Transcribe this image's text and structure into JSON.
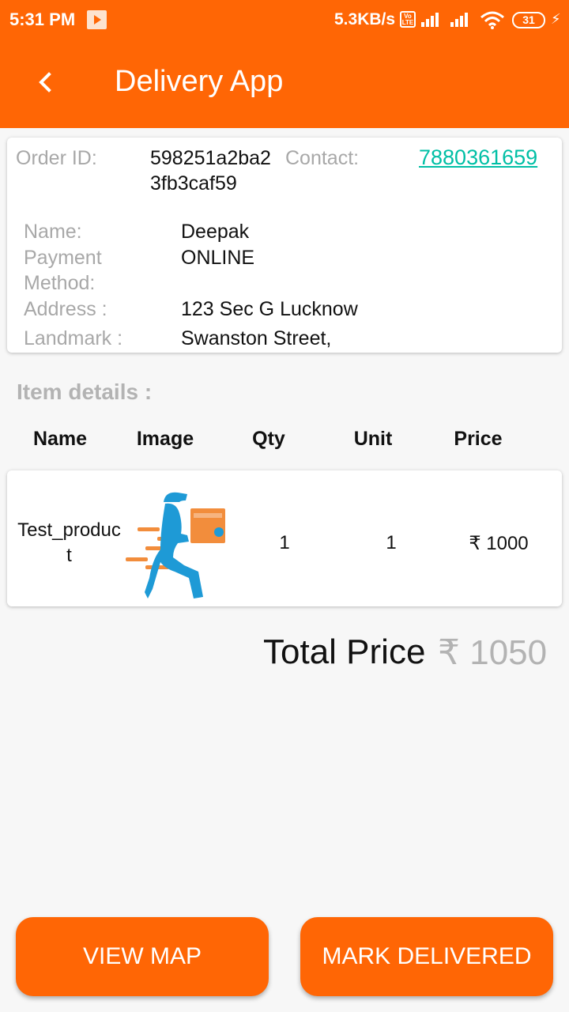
{
  "status_bar": {
    "time": "5:31 PM",
    "speed": "5.3KB/s",
    "volte": "Vo LTE",
    "battery": "31"
  },
  "app_bar": {
    "title": "Delivery App"
  },
  "order": {
    "order_id_label": "Order ID:",
    "order_id_line1": "598251a2ba2",
    "order_id_line2": "3fb3caf59",
    "contact_label": "Contact:",
    "contact_value": "7880361659",
    "name_label": "Name:",
    "name_value": "Deepak",
    "payment_label_line1": "Payment",
    "payment_label_line2": "Method:",
    "payment_value": "ONLINE",
    "address_label": "Address :",
    "address_value": "123 Sec G Lucknow",
    "landmark_label": "Landmark :",
    "landmark_value": "Swanston Street,"
  },
  "items": {
    "section_title": "Item details :",
    "headers": [
      "Name",
      "Image",
      "Qty",
      "Unit",
      "Price"
    ],
    "rows": [
      {
        "name_line1": "Test_produc",
        "name_line2": "t",
        "qty": "1",
        "unit": "1",
        "price": "₹ 1000"
      }
    ]
  },
  "total": {
    "label": "Total Price",
    "value": "₹ 1050"
  },
  "actions": {
    "view_map": "VIEW MAP",
    "mark_delivered": "MARK DELIVERED"
  },
  "colors": {
    "accent": "#ff6605",
    "link": "#00bfa5",
    "product_image_figure": "#1e9ad6",
    "product_image_box": "#f28d3c"
  }
}
